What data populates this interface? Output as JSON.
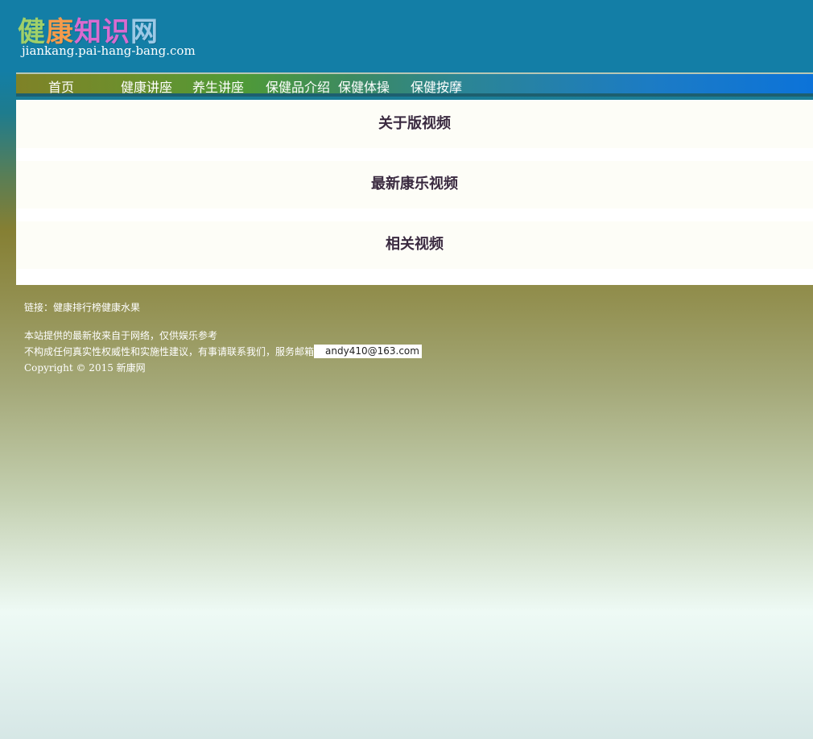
{
  "logo": {
    "chars": [
      "健",
      "康",
      "知",
      "识",
      "网"
    ],
    "url_text": "jiankang.pai-hang-bang.com"
  },
  "nav": {
    "items": [
      "首页",
      "健康讲座",
      "养生讲座",
      "保健品介绍",
      "保健体操",
      "保健按摩"
    ]
  },
  "sections": [
    {
      "title": "关于版视频"
    },
    {
      "title": "最新康乐视频"
    },
    {
      "title": "相关视频"
    }
  ],
  "footer": {
    "links_label": "链接：",
    "links": [
      "健康排行榜",
      "健康水果"
    ],
    "disclaimer_1": "本站提供的最新妆来自于网络，仅供娱乐参考",
    "disclaimer_2": "不构成任何真实性权威性和实施性建议，有事请联系我们，服务邮箱",
    "email": "andy410@163.com",
    "copyright": "Copyright © 2015 新康网"
  },
  "colors": {
    "header_blue": "#137ea6",
    "nav_start": "#7f8227",
    "nav_end": "#0c73d9",
    "section_title": "#3a2a40"
  }
}
